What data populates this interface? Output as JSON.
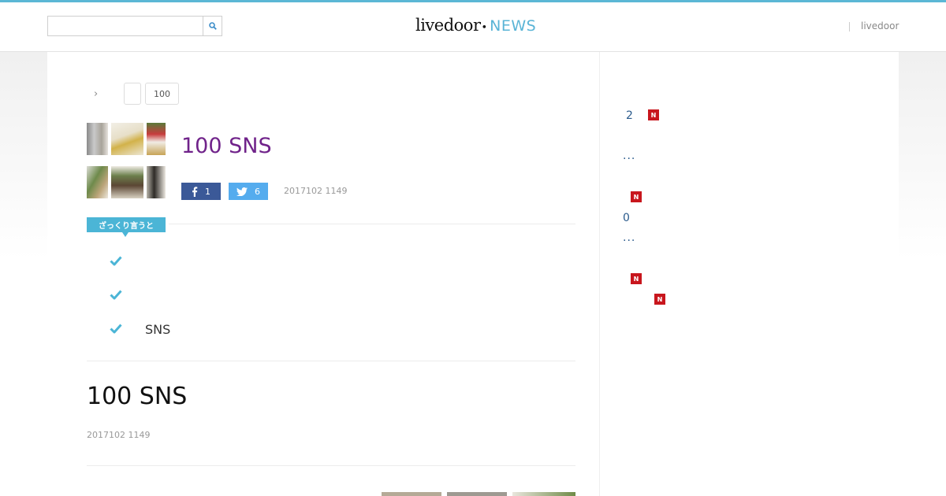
{
  "header": {
    "search_placeholder": "",
    "logo_main": "livedoor",
    "logo_news": "NEWS",
    "top_link": "livedoor"
  },
  "breadcrumb": {
    "separator": "›",
    "items": [
      "",
      "100"
    ]
  },
  "article": {
    "title": "100 SNS",
    "share": {
      "facebook_count": "1",
      "twitter_count": "6"
    },
    "date": "2017102 1149",
    "summary_label": "ざっくり言うと",
    "points": [
      "",
      "",
      "SNS"
    ],
    "body_title": "100 SNS",
    "body_date": "2017102 1149",
    "more_indicator": "..."
  },
  "sidebar": {
    "ranking": [
      {
        "text": "2",
        "badge": "N"
      },
      {
        "text": "...",
        "badge": ""
      },
      {
        "text": "",
        "badge": "N"
      },
      {
        "text": "0",
        "badge": ""
      },
      {
        "text": "...",
        "badge": ""
      },
      {
        "text": "",
        "badge": "N"
      },
      {
        "text": "",
        "badge": "N"
      }
    ]
  },
  "colors": {
    "accent": "#5bb7d5",
    "title": "#70238a",
    "facebook": "#3b5998",
    "twitter": "#55acee",
    "badge_new": "#c8161d",
    "link": "#2a5a8c"
  },
  "icons": [
    "search-icon",
    "chevron-right-icon",
    "facebook-icon",
    "twitter-icon",
    "check-icon"
  ]
}
